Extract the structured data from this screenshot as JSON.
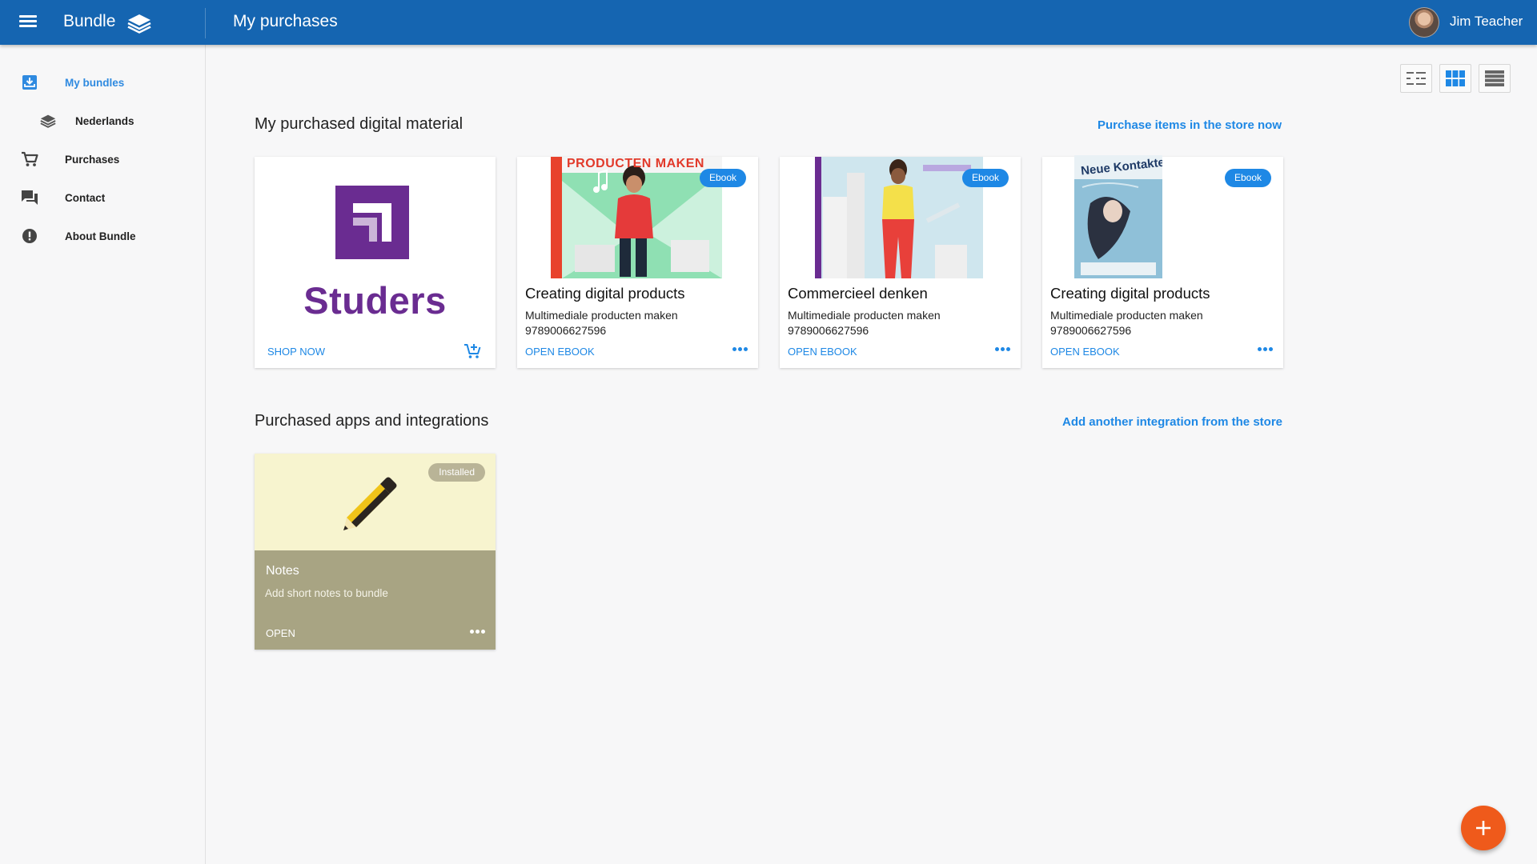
{
  "topbar": {
    "app_name": "Bundle",
    "page_title": "My purchases",
    "user_name": "Jim Teacher"
  },
  "sidebar": {
    "items": [
      {
        "label": "My bundles",
        "icon": "bundle-download-icon",
        "active": true
      },
      {
        "label": "Nederlands",
        "icon": "layers-icon",
        "active": false
      },
      {
        "label": "Purchases",
        "icon": "cart-icon",
        "active": false
      },
      {
        "label": "Contact",
        "icon": "chat-icon",
        "active": false
      },
      {
        "label": "About Bundle",
        "icon": "info-icon",
        "active": false
      }
    ]
  },
  "view_options": [
    "compact-list-view-icon",
    "grid-view-icon",
    "list-view-icon"
  ],
  "digital_material": {
    "title": "My purchased digital material",
    "link": "Purchase items in the store now",
    "store_card": {
      "brand": "Studers",
      "action": "SHOP NOW",
      "icon": "add-to-cart-icon"
    },
    "items": [
      {
        "badge": "Ebook",
        "title": "Creating digital products",
        "subtitle": "Multimediale producten maken",
        "isbn": "9789006627596",
        "action": "OPEN EBOOK",
        "cover_text": "PRODUCTEN MAKEN"
      },
      {
        "badge": "Ebook",
        "title": "Commercieel denken",
        "subtitle": "Multimediale producten maken",
        "isbn": "9789006627596",
        "action": "OPEN EBOOK"
      },
      {
        "badge": "Ebook",
        "title": "Creating digital products",
        "subtitle": "Multimediale producten maken",
        "isbn": "9789006627596",
        "action": "OPEN EBOOK",
        "cover_text": "Neue Kontakte"
      }
    ]
  },
  "apps": {
    "title": "Purchased apps and integrations",
    "link": "Add another integration from the store",
    "items": [
      {
        "badge": "Installed",
        "title": "Notes",
        "description": "Add short notes to bundle",
        "action": "OPEN",
        "icon": "pencil-icon"
      }
    ]
  },
  "colors": {
    "topbar": "#1565b1",
    "accent": "#1e88e5",
    "fab": "#ef5a1b",
    "studers_purple": "#6a2c91"
  }
}
